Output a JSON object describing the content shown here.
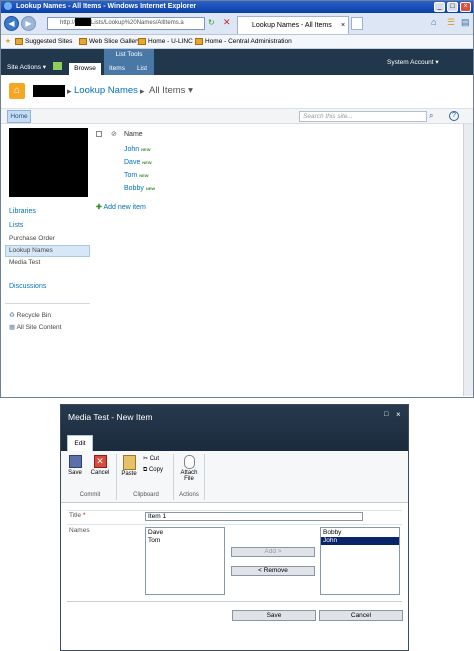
{
  "browser": {
    "title": "Lookup Names - All Items - Windows Internet Explorer",
    "url": "Lists/Lookup%20Names/AllItems.a",
    "url_prefix": "http://",
    "tab_title": "Lookup Names - All Items",
    "favorites": [
      "Suggested Sites",
      "Web Slice Gallery",
      "Home - U-LINC",
      "Home - Central Administration"
    ]
  },
  "ribbon": {
    "site_actions": "Site Actions",
    "browse_tab": "Browse",
    "list_tools": "List Tools",
    "items_tab": "Items",
    "list_tab": "List",
    "account": "System Account"
  },
  "breadcrumb": {
    "list": "Lookup Names",
    "view": "All Items"
  },
  "topnav": {
    "home": "Home",
    "search_placeholder": "Search this site..."
  },
  "quicklaunch": {
    "libraries": "Libraries",
    "lists": "Lists",
    "list_items": [
      "Purchase Order",
      "Lookup Names",
      "Media Test"
    ],
    "discussions": "Discussions",
    "recycle_bin": "Recycle Bin",
    "all_site_content": "All Site Content"
  },
  "list": {
    "column": "Name",
    "new_tag": "NEW",
    "items": [
      "John",
      "Dave",
      "Tom",
      "Bobby"
    ],
    "add_new": "Add new item"
  },
  "dialog": {
    "title": "Media Test - New Item",
    "edit_tab": "Edit",
    "save": "Save",
    "cancel": "Cancel",
    "paste": "Paste",
    "cut": "Cut",
    "copy": "Copy",
    "attach_line1": "Attach",
    "attach_line2": "File",
    "group_commit": "Commit",
    "group_clipboard": "Clipboard",
    "group_actions": "Actions",
    "title_label": "Title",
    "required_mark": "*",
    "title_value": "Item 1",
    "names_label": "Names",
    "available": [
      "Dave",
      "Tom"
    ],
    "selected": [
      "Bobby",
      "John"
    ],
    "add_button": "Add >",
    "remove_button": "< Remove",
    "footer_save": "Save",
    "footer_cancel": "Cancel"
  },
  "colors": {
    "ribbon_dark": "#21374c",
    "link_blue": "#0072bc",
    "selected_blue": "#0a246a",
    "titlebar_blue": "#0a3fa8"
  }
}
